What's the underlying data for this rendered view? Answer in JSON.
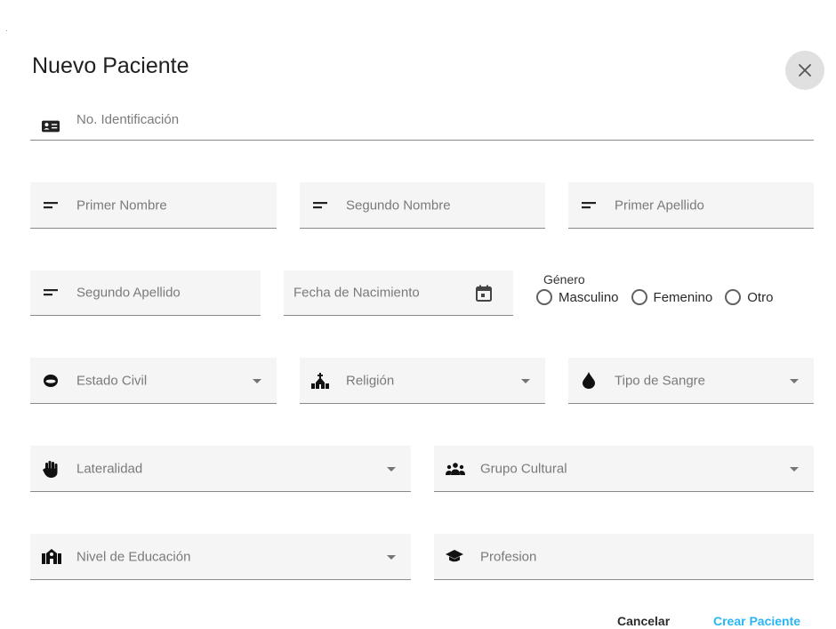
{
  "dialog": {
    "title": "Nuevo Paciente"
  },
  "form": {
    "identificacion": "No. Identificación",
    "primer_nombre": "Primer Nombre",
    "segundo_nombre": "Segundo Nombre",
    "primer_apellido": "Primer Apellido",
    "segundo_apellido": "Segundo Apellido",
    "fecha_nacimiento": "Fecha de Nacimiento",
    "genero": {
      "label": "Género",
      "options": [
        "Masculino",
        "Femenino",
        "Otro"
      ]
    },
    "estado_civil": "Estado Civil",
    "religion": "Religión",
    "tipo_sangre": "Tipo de Sangre",
    "lateralidad": "Lateralidad",
    "grupo_cultural": "Grupo Cultural",
    "nivel_educacion": "Nivel de Educación",
    "profesion": "Profesion"
  },
  "actions": {
    "cancel": "Cancelar",
    "create": "Crear Paciente"
  },
  "colors": {
    "accent": "#29b6f6",
    "field_bg": "#f5f5f5",
    "close_bg": "#e0e0e0"
  },
  "icons": {
    "close": "close-icon",
    "id_card": "id-card-icon",
    "short_text": "short-text-icon",
    "calendar": "calendar-icon",
    "ring": "ring-icon",
    "church": "church-icon",
    "blood_drop": "blood-drop-icon",
    "hand": "hand-icon",
    "group": "group-icon",
    "school": "school-icon",
    "graduation": "graduation-cap-icon"
  }
}
